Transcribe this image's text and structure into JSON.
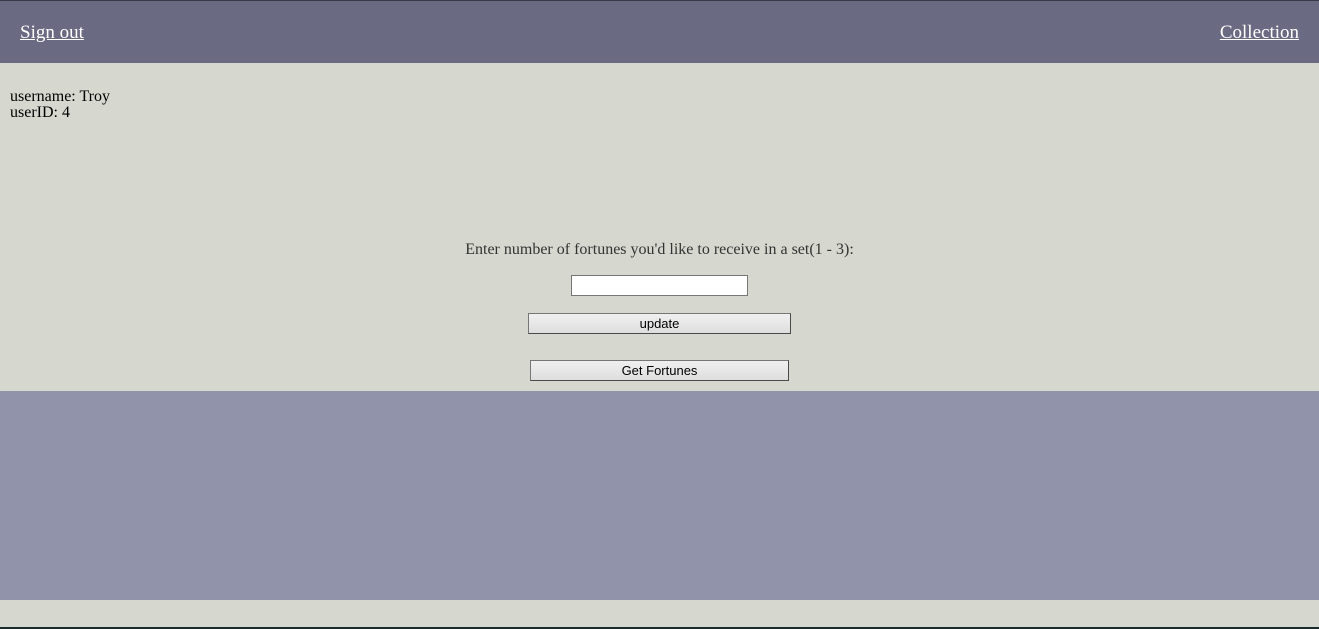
{
  "nav": {
    "sign_out_label": "Sign out",
    "collection_label": "Collection"
  },
  "user": {
    "username_text": "username: Troy",
    "userid_text": "userID: 4"
  },
  "fortune_form": {
    "prompt": "Enter number of fortunes you'd like to receive in a set(1 - 3):",
    "count_value": "",
    "update_label": "update",
    "get_fortunes_label": "Get Fortunes"
  },
  "colors": {
    "topbar": "#6a6a82",
    "page_background": "#d6d7cf",
    "results_panel": "#9193ab"
  }
}
